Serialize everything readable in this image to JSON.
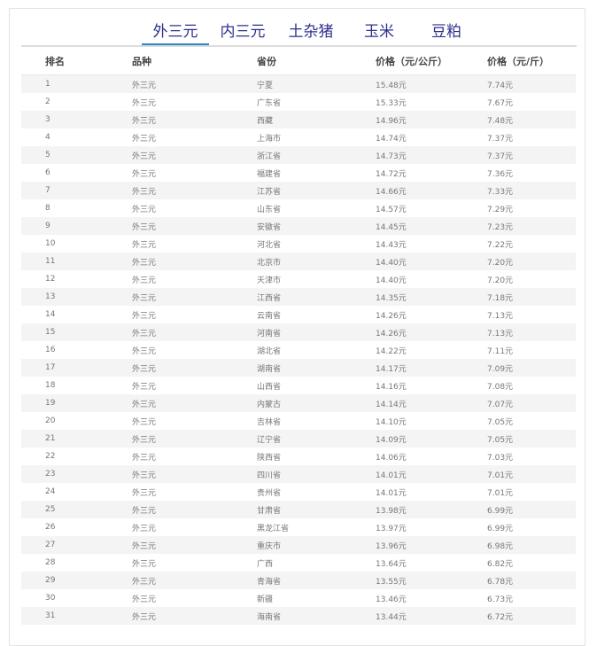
{
  "tabs": [
    {
      "label": "外三元",
      "active": true
    },
    {
      "label": "内三元",
      "active": false
    },
    {
      "label": "土杂猪",
      "active": false
    },
    {
      "label": "玉米",
      "active": false
    },
    {
      "label": "豆粕",
      "active": false
    }
  ],
  "table": {
    "headers": [
      "排名",
      "品种",
      "省份",
      "价格（元/公斤）",
      "价格（元/斤）"
    ],
    "rows": [
      [
        "1",
        "外三元",
        "宁夏",
        "15.48元",
        "7.74元"
      ],
      [
        "2",
        "外三元",
        "广东省",
        "15.33元",
        "7.67元"
      ],
      [
        "3",
        "外三元",
        "西藏",
        "14.96元",
        "7.48元"
      ],
      [
        "4",
        "外三元",
        "上海市",
        "14.74元",
        "7.37元"
      ],
      [
        "5",
        "外三元",
        "浙江省",
        "14.73元",
        "7.37元"
      ],
      [
        "6",
        "外三元",
        "福建省",
        "14.72元",
        "7.36元"
      ],
      [
        "7",
        "外三元",
        "江苏省",
        "14.66元",
        "7.33元"
      ],
      [
        "8",
        "外三元",
        "山东省",
        "14.57元",
        "7.29元"
      ],
      [
        "9",
        "外三元",
        "安徽省",
        "14.45元",
        "7.23元"
      ],
      [
        "10",
        "外三元",
        "河北省",
        "14.43元",
        "7.22元"
      ],
      [
        "11",
        "外三元",
        "北京市",
        "14.40元",
        "7.20元"
      ],
      [
        "12",
        "外三元",
        "天津市",
        "14.40元",
        "7.20元"
      ],
      [
        "13",
        "外三元",
        "江西省",
        "14.35元",
        "7.18元"
      ],
      [
        "14",
        "外三元",
        "云南省",
        "14.26元",
        "7.13元"
      ],
      [
        "15",
        "外三元",
        "河南省",
        "14.26元",
        "7.13元"
      ],
      [
        "16",
        "外三元",
        "湖北省",
        "14.22元",
        "7.11元"
      ],
      [
        "17",
        "外三元",
        "湖南省",
        "14.17元",
        "7.09元"
      ],
      [
        "18",
        "外三元",
        "山西省",
        "14.16元",
        "7.08元"
      ],
      [
        "19",
        "外三元",
        "内蒙古",
        "14.14元",
        "7.07元"
      ],
      [
        "20",
        "外三元",
        "吉林省",
        "14.10元",
        "7.05元"
      ],
      [
        "21",
        "外三元",
        "辽宁省",
        "14.09元",
        "7.05元"
      ],
      [
        "22",
        "外三元",
        "陕西省",
        "14.06元",
        "7.03元"
      ],
      [
        "23",
        "外三元",
        "四川省",
        "14.01元",
        "7.01元"
      ],
      [
        "24",
        "外三元",
        "贵州省",
        "14.01元",
        "7.01元"
      ],
      [
        "25",
        "外三元",
        "甘肃省",
        "13.98元",
        "6.99元"
      ],
      [
        "26",
        "外三元",
        "黑龙江省",
        "13.97元",
        "6.99元"
      ],
      [
        "27",
        "外三元",
        "重庆市",
        "13.96元",
        "6.98元"
      ],
      [
        "28",
        "外三元",
        "广西",
        "13.64元",
        "6.82元"
      ],
      [
        "29",
        "外三元",
        "青海省",
        "13.55元",
        "6.78元"
      ],
      [
        "30",
        "外三元",
        "新疆",
        "13.46元",
        "6.73元"
      ],
      [
        "31",
        "外三元",
        "海南省",
        "13.44元",
        "6.72元"
      ]
    ]
  }
}
